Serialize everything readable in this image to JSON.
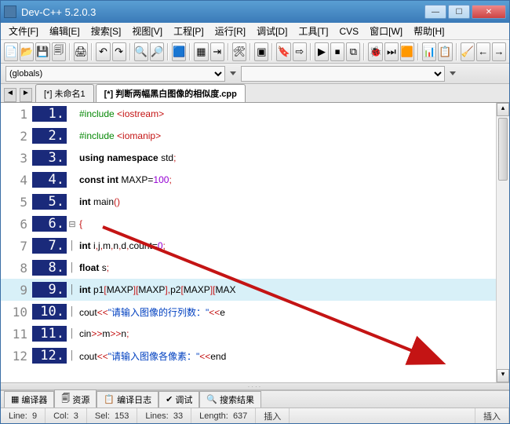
{
  "window": {
    "title": "Dev-C++ 5.2.0.3"
  },
  "menu": [
    "文件[F]",
    "编辑[E]",
    "搜索[S]",
    "视图[V]",
    "工程[P]",
    "运行[R]",
    "调试[D]",
    "工具[T]",
    "CVS",
    "窗口[W]",
    "帮助[H]"
  ],
  "toolbar_icons": [
    "📄",
    "📂",
    "💾",
    "🗐",
    "",
    "🖨",
    "",
    "↶",
    "↷",
    "",
    "🔍",
    "🔎",
    "",
    "🟦",
    "",
    "▦",
    "⇥",
    "",
    "🛠",
    "",
    "▣",
    "",
    "🔖",
    "⇨",
    "",
    "▶",
    "⏹",
    "⧉",
    "",
    "🐞",
    "⏭",
    "🟧",
    "",
    "📊",
    "📋",
    "",
    "🧹",
    "←",
    "→"
  ],
  "classbar": {
    "selected": "(globals)"
  },
  "tabs": {
    "prev": "◄",
    "next": "►",
    "items": [
      {
        "label": "[*] 未命名1",
        "active": false
      },
      {
        "label": "[*] 判断两幅黑白图像的相似度.cpp",
        "active": true
      }
    ]
  },
  "code": {
    "highlighted_line": 9,
    "fold_line": 6,
    "lines": [
      {
        "n": 1,
        "html": "<span class='dir'>#include</span> <span class='inc'>&lt;iostream&gt;</span>"
      },
      {
        "n": 2,
        "html": "<span class='dir'>#include</span> <span class='inc'>&lt;iomanip&gt;</span>"
      },
      {
        "n": 3,
        "html": "<span class='kw'>using</span> <span class='kw'>namespace</span> <span class='ident'>std</span><span class='sym'>;</span>"
      },
      {
        "n": 4,
        "html": "<span class='kw'>const</span> <span class='kw'>int</span> <span class='ident'>MAXP</span><span class='op'>=</span><span class='num'>100</span><span class='sym'>;</span>"
      },
      {
        "n": 5,
        "html": "<span class='kw'>int</span> <span class='ident'>main</span><span class='sym'>()</span>"
      },
      {
        "n": 6,
        "html": "<span class='sym'>{</span>"
      },
      {
        "n": 7,
        "html": "  <span class='kw'>int</span> <span class='ident'>i</span><span class='sym'>,</span><span class='ident'>j</span><span class='sym'>,</span><span class='ident'>m</span><span class='sym'>,</span><span class='ident'>n</span><span class='sym'>,</span><span class='ident'>d</span><span class='sym'>,</span><span class='ident'>count</span><span class='op'>=</span><span class='num'>0</span><span class='sym'>;</span>"
      },
      {
        "n": 8,
        "html": "  <span class='kw'>float</span> <span class='ident'>s</span><span class='sym'>;</span>"
      },
      {
        "n": 9,
        "html": "  <span class='kw'>int</span> <span class='ident'>p1</span><span class='sym'>[</span><span class='ident'>MAXP</span><span class='sym'>][</span><span class='ident'>MAXP</span><span class='sym'>],</span><span class='ident'>p2</span><span class='sym'>[</span><span class='ident'>MAXP</span><span class='sym'>][</span><span class='ident'>MAX</span>"
      },
      {
        "n": 10,
        "html": "  <span class='ident'>cout</span><span class='sym'>&lt;&lt;</span><span class='str'>\"请输入图像的行列数：\"</span><span class='sym'>&lt;&lt;</span><span class='ident'>e</span>"
      },
      {
        "n": 11,
        "html": "  <span class='ident'>cin</span><span class='sym'>&gt;&gt;</span><span class='ident'>m</span><span class='sym'>&gt;&gt;</span><span class='ident'>n</span><span class='sym'>;</span>"
      },
      {
        "n": 12,
        "html": "  <span class='ident'>cout</span><span class='sym'>&lt;&lt;</span><span class='str'>\"请输入图像各像素：\"</span><span class='sym'>&lt;&lt;</span><span class='ident'>end</span>"
      }
    ]
  },
  "bottom_tabs": [
    {
      "icon": "▦",
      "label": "编译器"
    },
    {
      "icon": "🗐",
      "label": "资源"
    },
    {
      "icon": "📋",
      "label": "编译日志"
    },
    {
      "icon": "✔",
      "label": "调试"
    },
    {
      "icon": "🔍",
      "label": "搜索结果"
    }
  ],
  "status": {
    "line_label": "Line:",
    "line": "9",
    "col_label": "Col:",
    "col": "3",
    "sel_label": "Sel:",
    "sel": "153",
    "lines_label": "Lines:",
    "lines": "33",
    "len_label": "Length:",
    "len": "637",
    "ins1": "插入",
    "ins2": "插入"
  }
}
